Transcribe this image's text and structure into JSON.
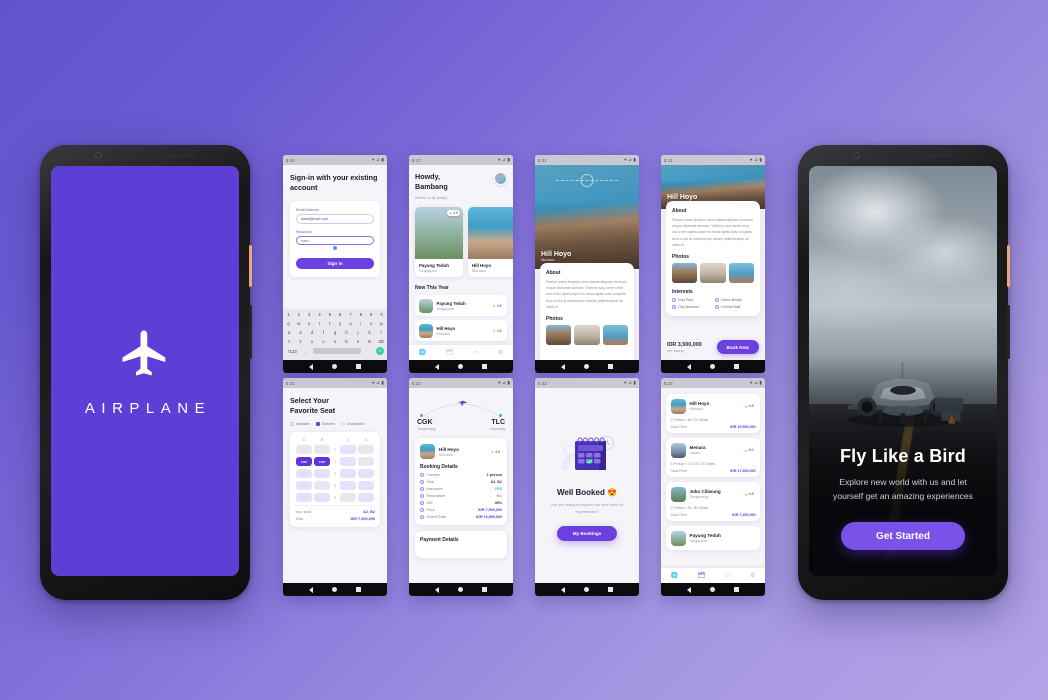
{
  "theme": {
    "bg_gradient_from": "#6253cd",
    "bg_gradient_to": "#b3a4e6",
    "brand_purple": "#6b3fe0",
    "splash_purple": "#5d3fd6",
    "accent_green": "#2ec4a6",
    "accent_star": "#ffb23f"
  },
  "splash": {
    "wordmark": "AIRPLANE",
    "icon": "airplane-icon"
  },
  "onboarding": {
    "title": "Fly Like a Bird",
    "subtitle": "Explore new world with us and let yourself get an amazing experiences",
    "cta": "Get Started"
  },
  "statusbars": {
    "signin": "5:16",
    "home": "5:17",
    "detail_top": "5:21",
    "detail_full": "5:21",
    "seats": "5:21",
    "booking": "5:22",
    "success": "5:22",
    "bookings": "5:22",
    "icons": "▾ ⊿ ▮"
  },
  "navbar": {
    "back": "back-triangle",
    "home": "home-circle",
    "recents": "recents-square"
  },
  "signin": {
    "title": "Sign-in with your existing account",
    "email_label": "Email Address",
    "email_value": "isans@mail.com",
    "password_label": "Password",
    "password_value": "••••••",
    "submit": "Sign In",
    "keyboard": {
      "row1": [
        "1",
        "2",
        "3",
        "4",
        "5",
        "6",
        "7",
        "8",
        "9",
        "0"
      ],
      "row2": [
        "q",
        "w",
        "e",
        "r",
        "t",
        "y",
        "u",
        "i",
        "o",
        "p"
      ],
      "row3": [
        "a",
        "s",
        "d",
        "f",
        "g",
        "h",
        "j",
        "k",
        "l"
      ],
      "row4": [
        "⇧",
        "z",
        "x",
        "c",
        "v",
        "b",
        "n",
        "m",
        "⌫"
      ],
      "row5_left": "?123",
      "row5_comma": ",",
      "row5_period": ".",
      "row5_enter": "✓"
    }
  },
  "home": {
    "greeting_line1": "Howdy,",
    "greeting_line2": "Bambang",
    "subtitle": "Where to fly today?",
    "avatar": "user-avatar",
    "popular_cards": [
      {
        "name": "Payung Teduh",
        "country": "Singapore",
        "rating": "4.9"
      },
      {
        "name": "Hill Hoyo",
        "country": "Monaco",
        "rating": "4.8"
      }
    ],
    "section_title": "New This Year",
    "list": [
      {
        "name": "Payung Teduh",
        "country": "Singapore",
        "rating": "4.8"
      },
      {
        "name": "Hill Hoyo",
        "country": "Monaco",
        "rating": "4.8"
      }
    ],
    "tabs": [
      "explore-icon",
      "bookings-icon",
      "card-icon",
      "settings-icon"
    ]
  },
  "detail": {
    "name": "Hill Hoyo",
    "country": "Monaco",
    "about_title": "About",
    "about_text": "Fames lorem tempus urna massa aliquam rhoncus neque dictumst aenean. Viverra nunc lorem erat orci enim ullamcorper eu tecia egitis cras voluptas. Arcu a dui at ullamcorper fames pellentesque ac vitae et.",
    "photos_title": "Photos",
    "interests_title": "Interests",
    "interests": [
      "Kids Park",
      "Honor Bridge",
      "City Museum",
      "Central Mall"
    ],
    "price": "IDR 3,500,000",
    "price_unit": "per orang",
    "book_cta": "Book Now"
  },
  "seats": {
    "title_line1": "Select Your",
    "title_line2": "Favorite Seat",
    "legend": [
      "Available",
      "Selected",
      "Unavailable"
    ],
    "columns": [
      "A",
      "B",
      "C",
      "D"
    ],
    "rows": [
      "1",
      "2",
      "3",
      "4",
      "5"
    ],
    "selected_label": "YOU",
    "grid": [
      [
        "unavailable",
        "unavailable",
        "highlight",
        "unavailable"
      ],
      [
        "selected",
        "selected",
        "highlight",
        "unavailable"
      ],
      [
        "highlight",
        "highlight",
        "highlight",
        "highlight"
      ],
      [
        "highlight",
        "unavailable",
        "highlight",
        "highlight"
      ],
      [
        "highlight",
        "highlight",
        "unavailable",
        "highlight"
      ]
    ],
    "your_seat_label": "Your seat",
    "your_seat_value": "A2, B2",
    "total_label": "Total",
    "total_value": "IDR 7,000,000"
  },
  "booking": {
    "origin_code": "CGK",
    "origin_city": "Tangerang",
    "dest_code": "TLC",
    "dest_city": "Cilenang",
    "dest_name": "Hill Hoyo",
    "dest_country": "Monaco",
    "dest_rating": "4.8",
    "details_title": "Booking Details",
    "rows": [
      {
        "label": "Traveler",
        "value": "1 person",
        "tone": "plain"
      },
      {
        "label": "Seat",
        "value": "A2, B2",
        "tone": "plain"
      },
      {
        "label": "Insurance",
        "value": "YES",
        "tone": "pos"
      },
      {
        "label": "Refundable",
        "value": "NO",
        "tone": "neg"
      },
      {
        "label": "VAT",
        "value": "45%",
        "tone": "plain"
      },
      {
        "label": "Price",
        "value": "IDR 7,500,000",
        "tone": "acc"
      },
      {
        "label": "Grand Total",
        "value": "IDR 10,850,000",
        "tone": "acc"
      }
    ],
    "payment_title": "Payment Details"
  },
  "success": {
    "title": "Well Booked 😍",
    "subtitle": "Are you ready to explore the new world of experiences?",
    "cta": "My Bookings"
  },
  "bookings": {
    "items": [
      {
        "name": "Hill Hoyo",
        "country": "Monaco",
        "rating": "4.8",
        "pax": "2 Person • B4, C4 Seats",
        "total_label": "Total Price",
        "total_value": "IDR 15,500,000"
      },
      {
        "name": "Menara",
        "country": "Japan",
        "rating": "5.0",
        "pax": "5 Person • C4, D4, D5 Seats",
        "total_label": "Total Price",
        "total_value": "IDR 17,400,000"
      },
      {
        "name": "Joko Ciliwung",
        "country": "Tangerang",
        "rating": "4.8",
        "pax": "2 Person • B1, B4 Seats",
        "total_label": "Total Price",
        "total_value": "IDR 7,250,000"
      }
    ],
    "partial_item": {
      "name": "Payung Teduh",
      "country": "Singapore"
    },
    "tabs": [
      "explore-icon",
      "bookings-icon",
      "card-icon",
      "settings-icon"
    ]
  }
}
